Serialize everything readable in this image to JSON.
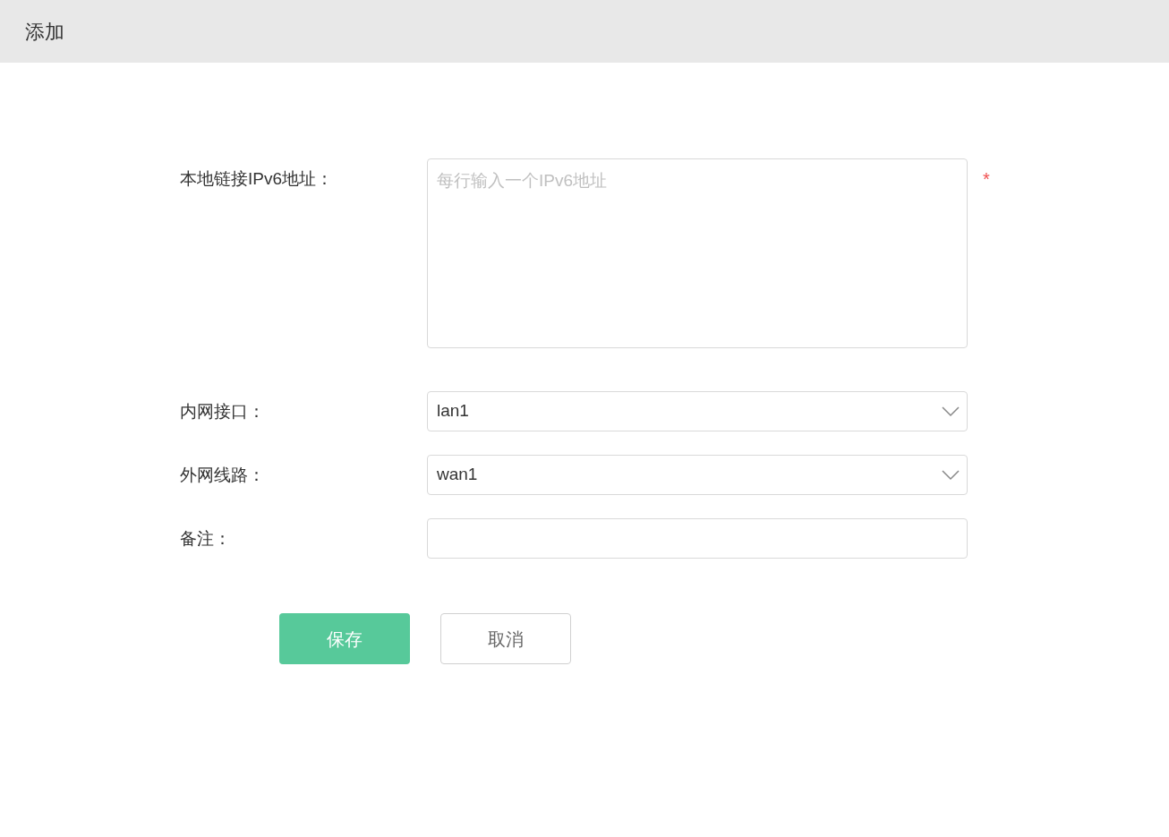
{
  "header": {
    "title": "添加"
  },
  "fields": [
    {
      "kind": "textarea",
      "label": "本地链接IPv6地址：",
      "placeholder": "每行输入一个IPv6地址",
      "required_mark": "*"
    },
    {
      "kind": "select",
      "label": "内网接口：",
      "value": "lan1"
    },
    {
      "kind": "select",
      "label": "外网线路：",
      "value": "wan1"
    },
    {
      "kind": "text",
      "label": "备注："
    }
  ],
  "buttons": [
    {
      "kind": "primary",
      "label": "保存"
    },
    {
      "kind": "secondary",
      "label": "取消"
    }
  ]
}
